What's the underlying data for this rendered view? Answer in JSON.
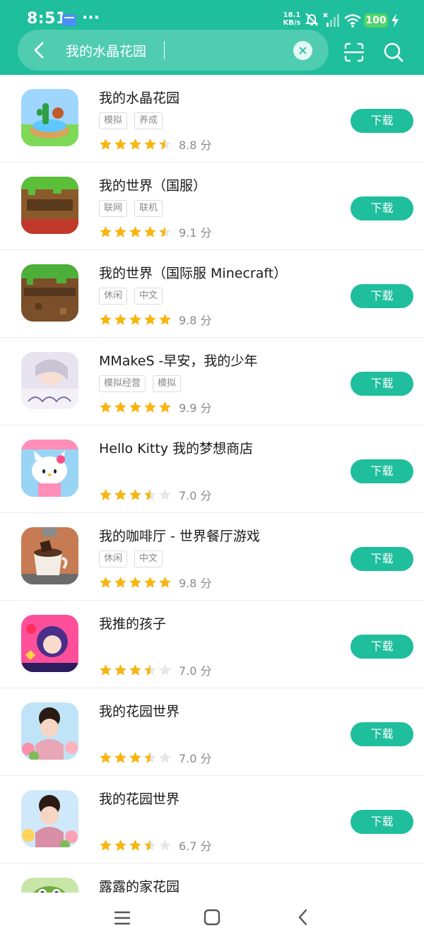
{
  "status_bar": {
    "time": "8:51",
    "extra": "···",
    "net_speed_value": "18.1",
    "net_speed_unit": "KB/s",
    "battery": "100"
  },
  "search": {
    "query": "我的水晶花园"
  },
  "apps": [
    {
      "name": "我的水晶花园",
      "tags": [
        "模拟",
        "养成"
      ],
      "rating": 4.5,
      "score": "8.8 分",
      "download": "下载"
    },
    {
      "name": "我的世界（国服）",
      "tags": [
        "联网",
        "联机"
      ],
      "rating": 4.5,
      "score": "9.1 分",
      "download": "下载"
    },
    {
      "name": "我的世界（国际服 Minecraft）",
      "tags": [
        "休闲",
        "中文"
      ],
      "rating": 5,
      "score": "9.8 分",
      "download": "下载"
    },
    {
      "name": "MMakeS -早安，我的少年",
      "tags": [
        "模拟经营",
        "模拟"
      ],
      "rating": 5,
      "score": "9.9 分",
      "download": "下载"
    },
    {
      "name": "Hello Kitty 我的梦想商店",
      "tags": [],
      "rating": 3.5,
      "score": "7.0 分",
      "download": "下载"
    },
    {
      "name": "我的咖啡厅 - 世界餐厅游戏",
      "tags": [
        "休闲",
        "中文"
      ],
      "rating": 5,
      "score": "9.8 分",
      "download": "下载"
    },
    {
      "name": "我推的孩子",
      "tags": [],
      "rating": 3.5,
      "score": "7.0 分",
      "download": "下载"
    },
    {
      "name": "我的花园世界",
      "tags": [],
      "rating": 3.5,
      "score": "7.0 分",
      "download": "下载"
    },
    {
      "name": "我的花园世界",
      "tags": [],
      "rating": 3.5,
      "score": "6.7 分",
      "download": "下载"
    },
    {
      "name": "露露的家花园",
      "tags": [],
      "rating": null,
      "score": "",
      "download": ""
    }
  ],
  "colors": {
    "accent": "#1fbe9c",
    "star": "#f7b50e",
    "star_empty": "#e6e6e6"
  }
}
